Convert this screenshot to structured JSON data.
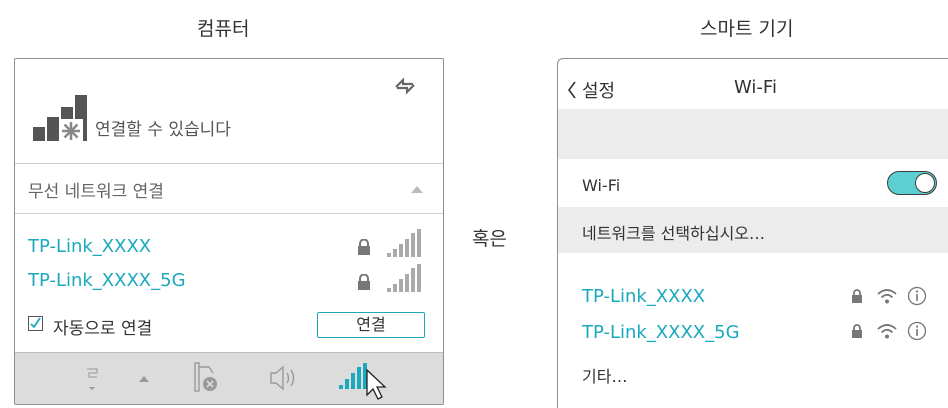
{
  "captions": {
    "computer": "컴퓨터",
    "or": "혹은",
    "smart_device": "스마트 기기"
  },
  "computer": {
    "status_text": "연결할 수 있습니다",
    "section_title": "무선 네트워크 연결",
    "networks": [
      {
        "name": "TP-Link_XXXX"
      },
      {
        "name": "TP-Link_XXXX_5G"
      }
    ],
    "auto_connect": {
      "checked": true,
      "label": "자동으로 연결"
    },
    "connect_button": "연결",
    "icons": [
      "refresh-icon",
      "signal-star-icon",
      "lock-icon",
      "signal-bars-icon",
      "chevron-up-icon",
      "network-unavailable-icon",
      "speaker-icon",
      "wifi-tray-icon",
      "cursor-icon"
    ]
  },
  "phone": {
    "back_label": "설정",
    "title": "Wi-Fi",
    "wifi_label": "Wi-Fi",
    "wifi_on": true,
    "choose_network": "네트워크를 선택하십시오…",
    "networks": [
      {
        "name": "TP-Link_XXXX"
      },
      {
        "name": "TP-Link_XXXX_5G"
      }
    ],
    "other": "기타…"
  },
  "colors": {
    "accent": "#1aa9bd",
    "toggle_on": "#5ccfd2",
    "band": "#ececec",
    "taskbar": "#dcdcdc"
  }
}
